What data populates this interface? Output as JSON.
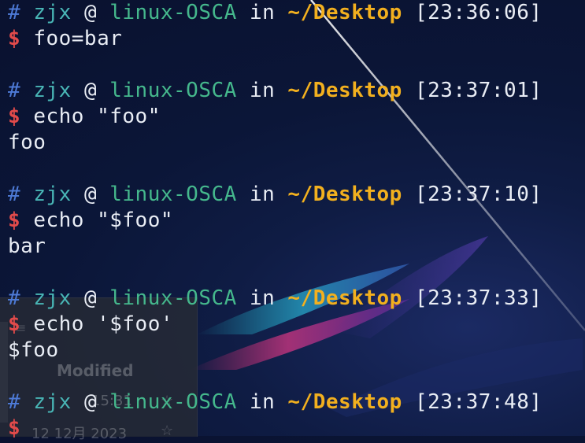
{
  "prompt": {
    "hash": "#",
    "user": "zjx",
    "at": "@",
    "host": "linux-OSCA",
    "in": "in",
    "path": "~/Desktop",
    "dollar": "$"
  },
  "entries": [
    {
      "time": "[23:36:06]",
      "command": "foo=bar"
    },
    {
      "time": "[23:37:01]",
      "command": "echo \"foo\"",
      "output": "foo"
    },
    {
      "time": "[23:37:10]",
      "command": "echo \"$foo\"",
      "output": "bar"
    },
    {
      "time": "[23:37:33]",
      "command": "echo '$foo'",
      "output": "$foo"
    },
    {
      "time": "[23:37:48]"
    }
  ],
  "file_panel": {
    "header": "Modified",
    "rows": [
      {
        "value": "15:31"
      },
      {
        "value": "12 12月 2023"
      }
    ]
  },
  "icons": {
    "star": "star-icon",
    "list": "list-icon"
  }
}
